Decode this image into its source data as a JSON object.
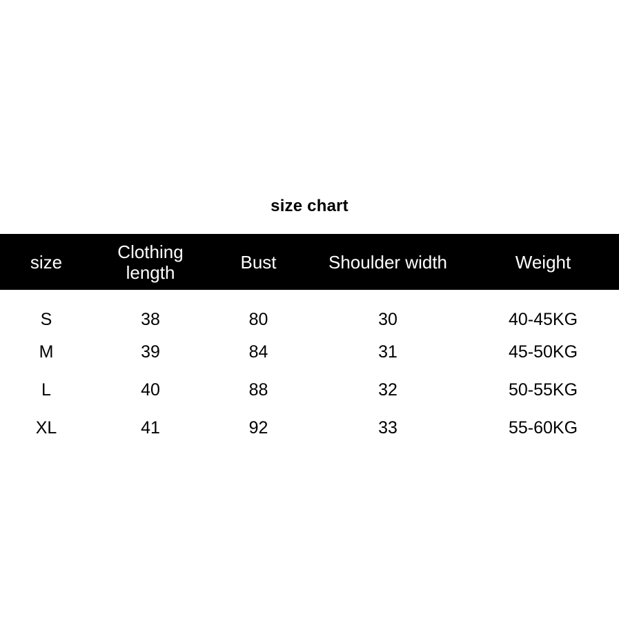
{
  "background_color": "#ffffff",
  "header_background_color": "#000000",
  "header_text_color": "#ffffff",
  "body_text_color": "#000000",
  "title": "size chart",
  "table": {
    "columns": [
      {
        "key": "size",
        "label": "size"
      },
      {
        "key": "length",
        "label": "Clothing length"
      },
      {
        "key": "bust",
        "label": "Bust"
      },
      {
        "key": "shoulder",
        "label": "Shoulder width"
      },
      {
        "key": "weight",
        "label": "Weight"
      }
    ],
    "rows": [
      {
        "size": "S",
        "length": "38",
        "bust": "80",
        "shoulder": "30",
        "weight": "40-45KG"
      },
      {
        "size": "M",
        "length": "39",
        "bust": "84",
        "shoulder": "31",
        "weight": "45-50KG"
      },
      {
        "size": "L",
        "length": "40",
        "bust": "88",
        "shoulder": "32",
        "weight": "50-55KG"
      },
      {
        "size": "XL",
        "length": "41",
        "bust": "92",
        "shoulder": "33",
        "weight": "55-60KG"
      }
    ]
  }
}
